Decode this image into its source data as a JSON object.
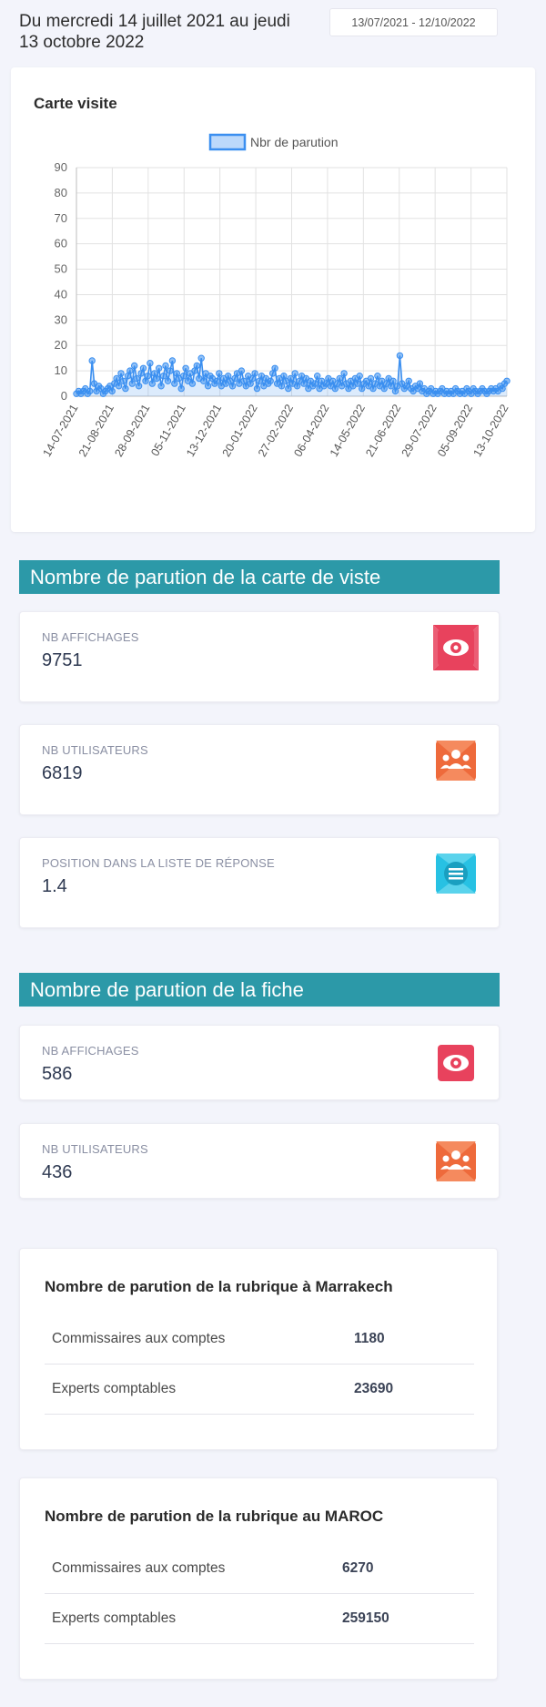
{
  "header": {
    "date_range_text": "Du mercredi 14 juillet 2021 au jeudi 13 octobre 2022",
    "date_input_value": "13/07/2021 - 12/10/2022"
  },
  "chart_card": {
    "title": "Carte visite"
  },
  "chart_data": {
    "type": "line",
    "legend": "Nbr de parution",
    "legend_position": "top",
    "ylim": [
      0,
      90
    ],
    "y_ticks": [
      0,
      10,
      20,
      30,
      40,
      50,
      60,
      70,
      80,
      90
    ],
    "x_tick_labels": [
      "14-07-2021",
      "21-08-2021",
      "28-09-2021",
      "05-11-2021",
      "13-12-2021",
      "20-01-2022",
      "27-02-2022",
      "06-04-2022",
      "14-05-2022",
      "21-06-2022",
      "29-07-2022",
      "05-09-2022",
      "13-10-2022"
    ],
    "grid": true,
    "color": "#3b8ff0",
    "series": [
      {
        "name": "Nbr de parution",
        "values": [
          1,
          2,
          1,
          2,
          3,
          1,
          2,
          14,
          5,
          2,
          4,
          3,
          1,
          2,
          3,
          4,
          2,
          5,
          7,
          4,
          9,
          6,
          3,
          8,
          10,
          5,
          12,
          7,
          4,
          9,
          11,
          6,
          8,
          13,
          5,
          9,
          7,
          11,
          4,
          8,
          12,
          6,
          10,
          14,
          5,
          9,
          7,
          3,
          8,
          11,
          6,
          9,
          5,
          10,
          12,
          7,
          15,
          6,
          9,
          4,
          8,
          7,
          5,
          6,
          9,
          4,
          7,
          5,
          8,
          6,
          4,
          7,
          9,
          5,
          10,
          6,
          4,
          8,
          5,
          7,
          9,
          3,
          6,
          8,
          4,
          7,
          5,
          6,
          9,
          11,
          5,
          7,
          4,
          8,
          6,
          3,
          7,
          5,
          9,
          4,
          6,
          8,
          5,
          7,
          3,
          6,
          4,
          5,
          8,
          3,
          6,
          4,
          5,
          7,
          4,
          6,
          3,
          5,
          7,
          4,
          9,
          5,
          3,
          6,
          4,
          7,
          5,
          8,
          3,
          5,
          6,
          4,
          7,
          3,
          5,
          8,
          4,
          6,
          3,
          5,
          7,
          4,
          6,
          2,
          4,
          16,
          5,
          3,
          4,
          6,
          3,
          2,
          4,
          3,
          5,
          2,
          3,
          1,
          2,
          3,
          1,
          2,
          1,
          2,
          3,
          1,
          2,
          1,
          2,
          1,
          3,
          2,
          1,
          2,
          1,
          3,
          2,
          1,
          3,
          2,
          1,
          2,
          3,
          2,
          1,
          2,
          3,
          2,
          3,
          2,
          4,
          3,
          5,
          6
        ]
      }
    ]
  },
  "sections": {
    "carte_visite": {
      "title": "Nombre de parution de la carte de viste",
      "stats": [
        {
          "label": "NB AFFICHAGES",
          "value": "9751",
          "icon": "eye-icon",
          "color": "#e8425d"
        },
        {
          "label": "NB UTILISATEURS",
          "value": "6819",
          "icon": "users-icon",
          "color": "#ee6a3b"
        },
        {
          "label": "POSITION DANS LA LISTE DE RÉPONSE",
          "value": "1.4",
          "icon": "list-icon",
          "color": "#27c1e3"
        }
      ]
    },
    "fiche": {
      "title": "Nombre de parution de la fiche",
      "stats": [
        {
          "label": "NB AFFICHAGES",
          "value": "586",
          "icon": "eye-icon",
          "color": "#e8425d"
        },
        {
          "label": "NB UTILISATEURS",
          "value": "436",
          "icon": "users-icon",
          "color": "#ee6a3b"
        }
      ]
    }
  },
  "rubriques": [
    {
      "title": "Nombre de parution de la rubrique à Marrakech",
      "rows": [
        {
          "name": "Commissaires aux comptes",
          "value": "1180"
        },
        {
          "name": "Experts comptables",
          "value": "23690"
        }
      ]
    },
    {
      "title": "Nombre de parution de la rubrique au MAROC",
      "rows": [
        {
          "name": "Commissaires aux comptes",
          "value": "6270"
        },
        {
          "name": "Experts comptables",
          "value": "259150"
        }
      ]
    }
  ]
}
